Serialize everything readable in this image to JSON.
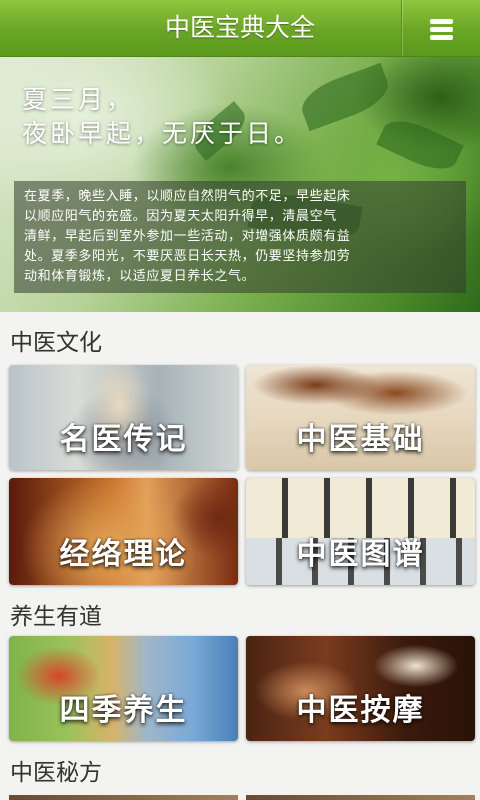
{
  "header": {
    "title": "中医宝典大全",
    "menu_icon": "menu-icon"
  },
  "banner": {
    "headline_line1": "夏三月，",
    "headline_line2": "夜卧早起，无厌于日。",
    "desc_lines": [
      "在夏季，晚些入睡，以顺应自然阴气的不足，早些起床",
      "以顺应阳气的充盛。因为夏天太阳升得早，清晨空气",
      "清鲜，早起后到室外参加一些活动，对增强体质颇有益",
      "处。夏季多阳光，不要厌恶日长天热，仍要坚持参加劳",
      "动和体育锻炼，以适应夏日养长之气。"
    ]
  },
  "sections": [
    {
      "title": "中医文化",
      "cards": [
        {
          "label": "名医传记"
        },
        {
          "label": "中医基础"
        },
        {
          "label": "经络理论"
        },
        {
          "label": "中医图谱"
        }
      ]
    },
    {
      "title": "养生有道",
      "cards": [
        {
          "label": "四季养生"
        },
        {
          "label": "中医按摩"
        }
      ]
    },
    {
      "title": "中医秘方",
      "cards": []
    }
  ],
  "colors": {
    "header_green": "#6aa525",
    "page_bg": "#f3f3f1"
  }
}
